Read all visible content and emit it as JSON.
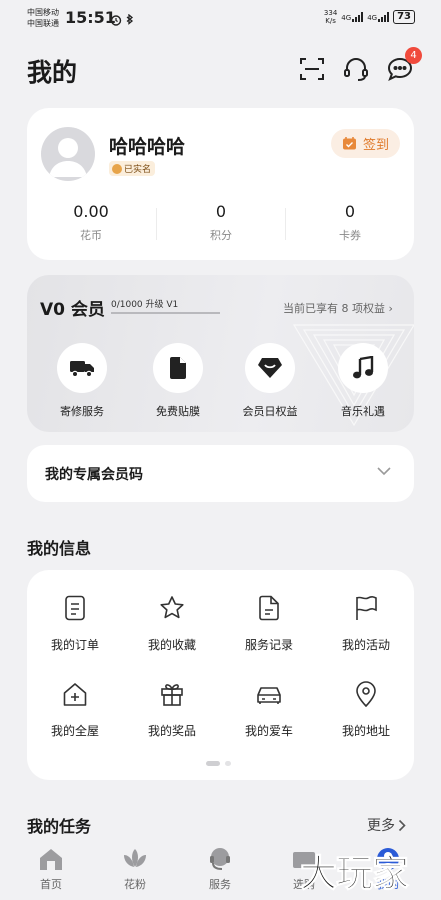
{
  "status_bar": {
    "carrier_1": "中国移动",
    "carrier_2": "中国联通",
    "time": "15:51",
    "net_speed_value": "334",
    "net_speed_unit": "K/s",
    "sim1_network": "4G",
    "sim2_network": "4G",
    "battery": "73"
  },
  "header": {
    "title": "我的",
    "message_badge": "4",
    "icons": [
      "scan-icon",
      "headset-icon",
      "message-icon"
    ]
  },
  "profile": {
    "name": "哈哈哈哈",
    "verified_label": "已实名",
    "checkin_label": "签到",
    "stats": [
      {
        "value": "0.00",
        "label": "花币"
      },
      {
        "value": "0",
        "label": "积分"
      },
      {
        "value": "0",
        "label": "卡券"
      }
    ]
  },
  "member": {
    "title": "V0 会员",
    "progress_text": "0/1000 升级 V1",
    "progress": 0,
    "benefits_text": "当前已享有 8 项权益",
    "items": [
      {
        "label": "寄修服务",
        "icon": "truck-icon"
      },
      {
        "label": "免费贴膜",
        "icon": "phone-film-icon"
      },
      {
        "label": "会员日权益",
        "icon": "member-day-icon"
      },
      {
        "label": "音乐礼遇",
        "icon": "music-icon"
      }
    ]
  },
  "member_code": {
    "title": "我的专属会员码"
  },
  "my_info": {
    "title": "我的信息",
    "items": [
      {
        "label": "我的订单",
        "icon": "order-icon"
      },
      {
        "label": "我的收藏",
        "icon": "star-icon"
      },
      {
        "label": "服务记录",
        "icon": "record-icon"
      },
      {
        "label": "我的活动",
        "icon": "flag-icon"
      },
      {
        "label": "我的全屋",
        "icon": "house-icon"
      },
      {
        "label": "我的奖品",
        "icon": "gift-icon"
      },
      {
        "label": "我的爱车",
        "icon": "car-icon"
      },
      {
        "label": "我的地址",
        "icon": "location-icon"
      }
    ]
  },
  "my_tasks": {
    "title": "我的任务",
    "more_label": "更多"
  },
  "tab_bar": {
    "tabs": [
      {
        "label": "首页",
        "icon": "home-icon"
      },
      {
        "label": "花粉",
        "icon": "lotus-icon"
      },
      {
        "label": "服务",
        "icon": "service-icon"
      },
      {
        "label": "选购",
        "icon": "shop-icon"
      },
      {
        "label": "我的",
        "icon": "profile-icon"
      }
    ],
    "active": "我的"
  },
  "watermark": "大玩家",
  "colors": {
    "accent_orange": "#e07a2a",
    "badge_red": "#f04a3c",
    "active_blue": "#2b5bd7"
  }
}
